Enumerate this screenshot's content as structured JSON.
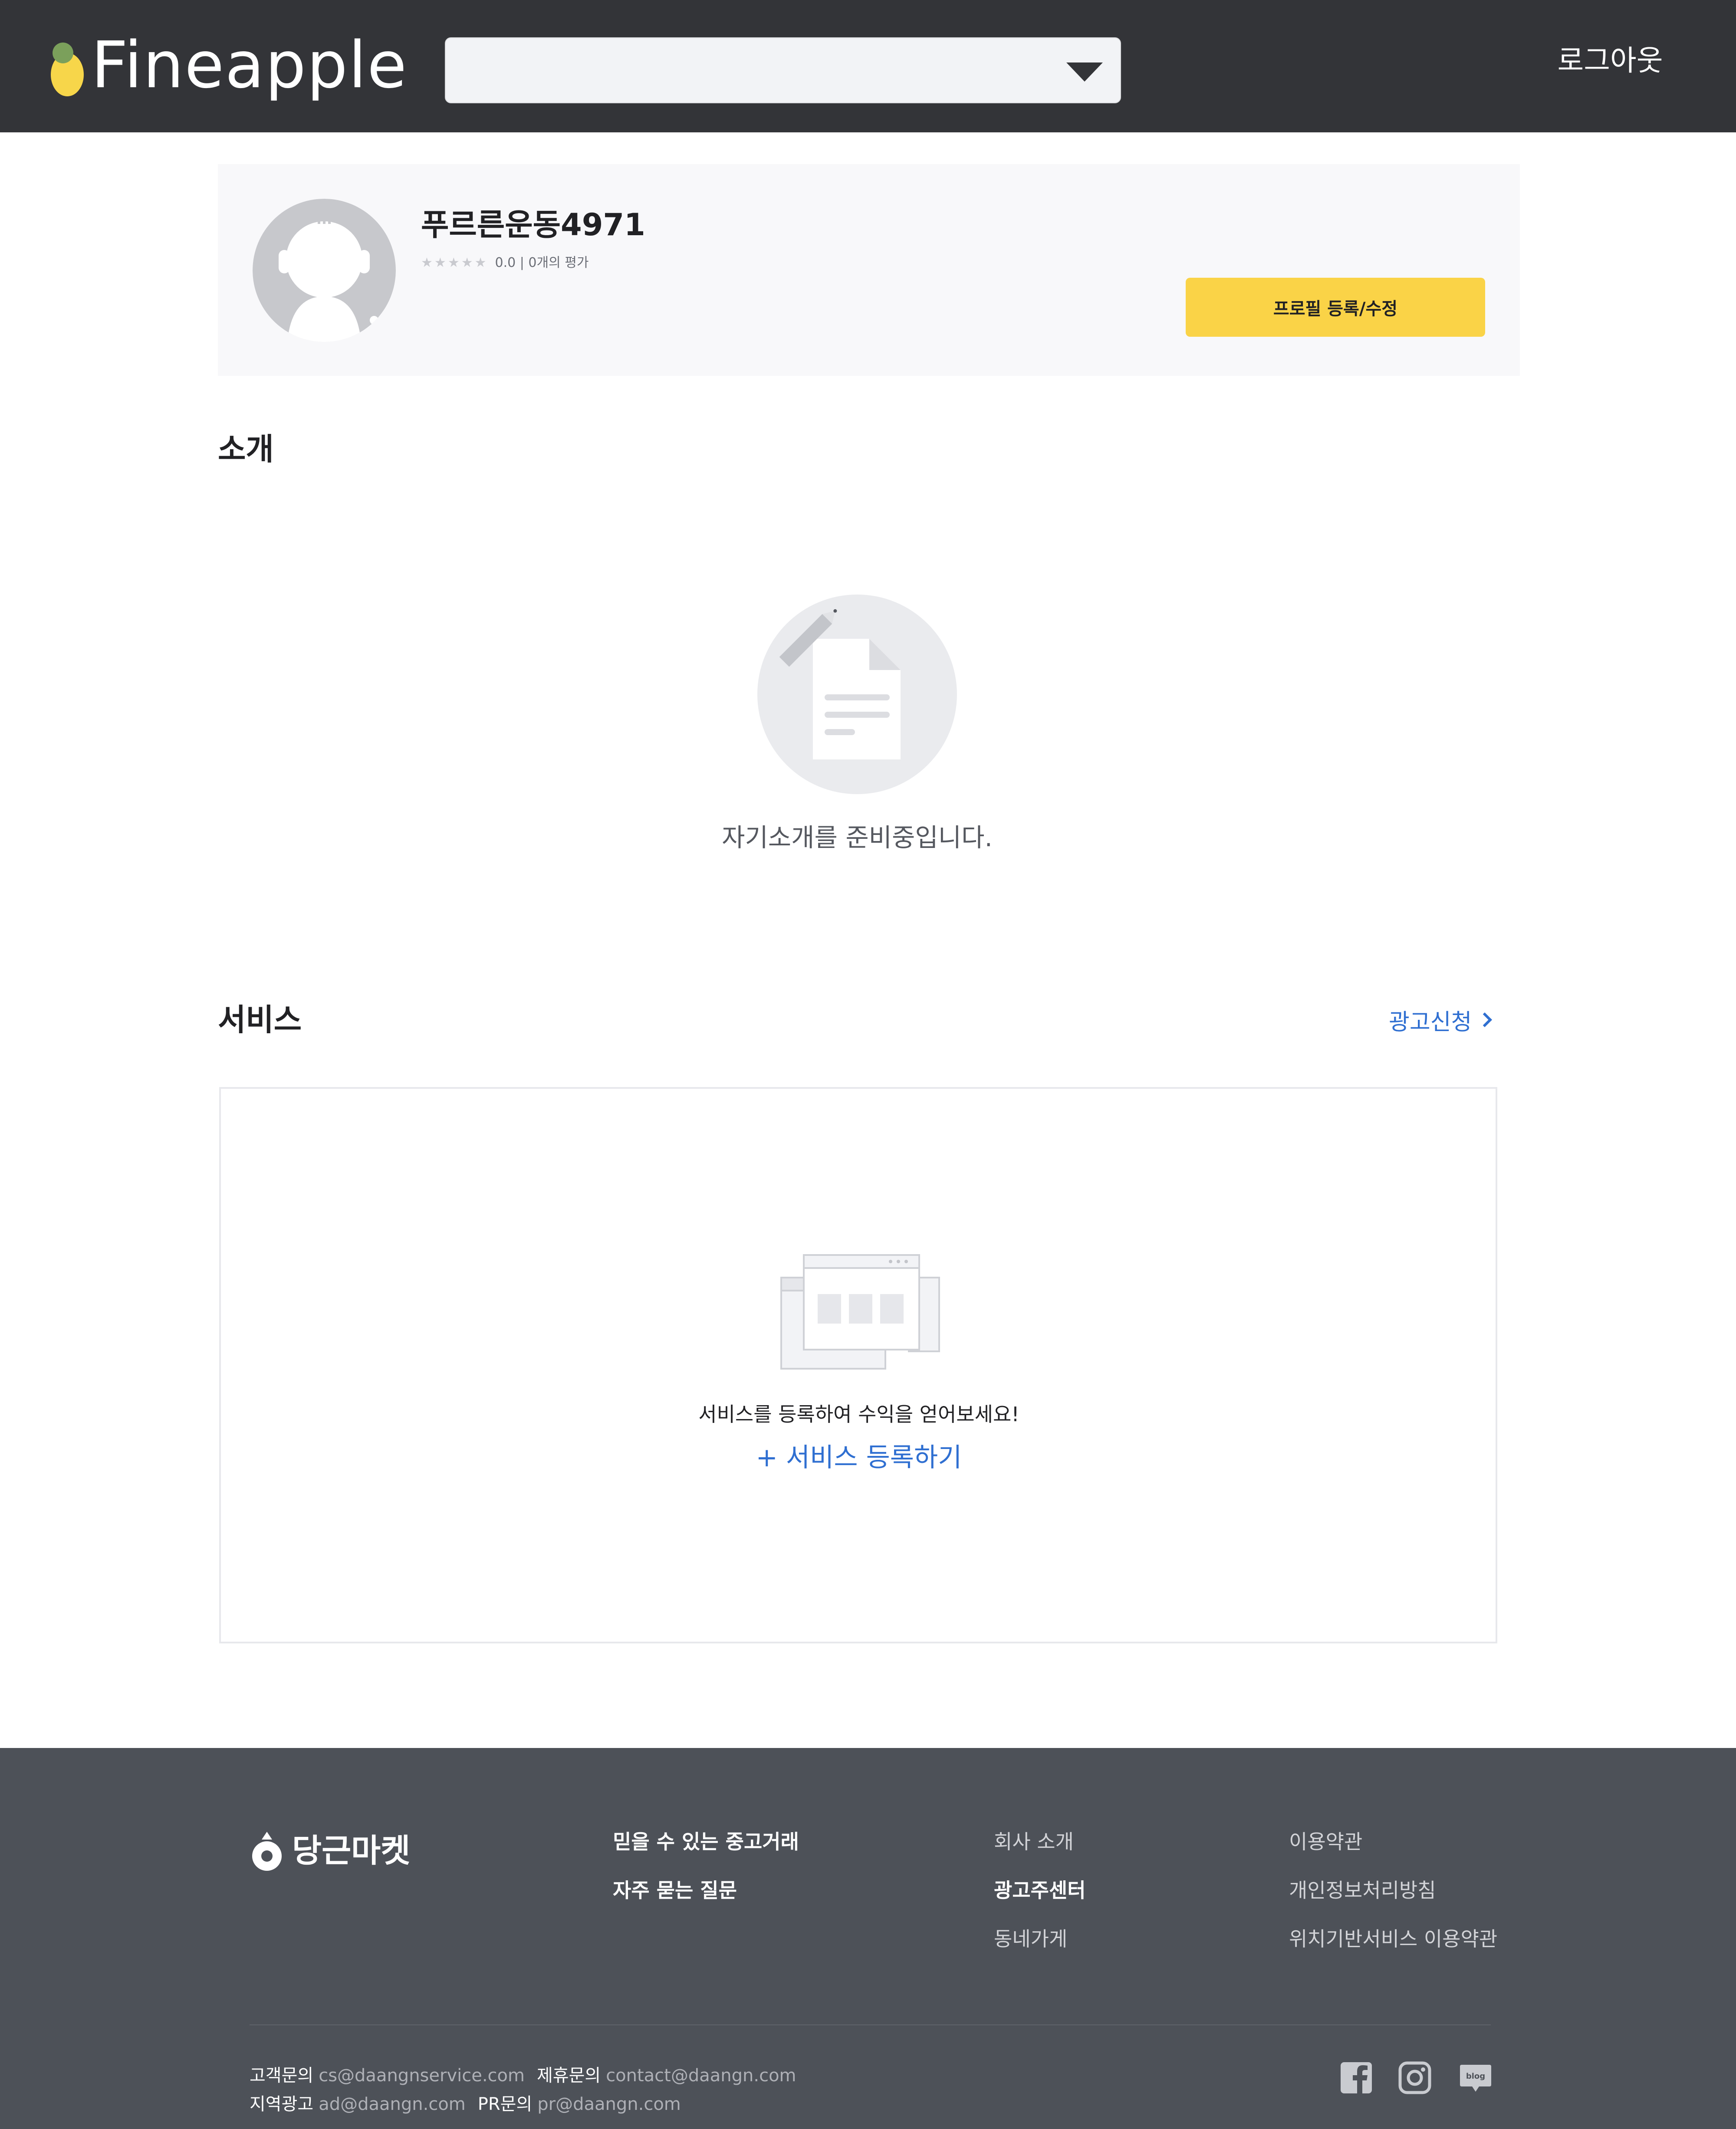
{
  "header": {
    "logo_text": "Fineapple",
    "select_value": "",
    "logout_label": "로그아웃"
  },
  "profile": {
    "username": "푸르른운동4971",
    "stars": [
      "★",
      "★",
      "★",
      "★",
      "★"
    ],
    "rating_text": "0.0 | 0개의 평가",
    "edit_button_label": "프로필 등록/수정"
  },
  "intro": {
    "title": "소개",
    "empty_text": "자기소개를 준비중입니다."
  },
  "service": {
    "title": "서비스",
    "ad_link_label": "광고신청",
    "empty_text": "서비스를 등록하여 수익을 얻어보세요!",
    "add_link_label": "+ 서비스 등록하기"
  },
  "footer": {
    "logo_text": "당근마켓",
    "col1": [
      "믿을 수 있는 중고거래",
      "자주 묻는 질문"
    ],
    "col2": [
      "회사 소개",
      "광고주센터",
      "동네가게"
    ],
    "col3": [
      "이용약관",
      "개인정보처리방침",
      "위치기반서비스 이용약관"
    ],
    "contacts_row1": [
      {
        "label": "고객문의",
        "value": "cs@daangnservice.com"
      },
      {
        "label": "제휴문의",
        "value": "contact@daangn.com"
      }
    ],
    "contacts_row2": [
      {
        "label": "지역광고",
        "value": "ad@daangn.com"
      },
      {
        "label": "PR문의",
        "value": "pr@daangn.com"
      }
    ],
    "social_icons": [
      "facebook-icon",
      "instagram-icon",
      "blog-icon"
    ],
    "blog_icon_text": "blog"
  },
  "colors": {
    "header_bg": "#333438",
    "accent_yellow": "#fad347",
    "link_blue": "#2f6fd1",
    "footer_bg": "#4d5158"
  }
}
